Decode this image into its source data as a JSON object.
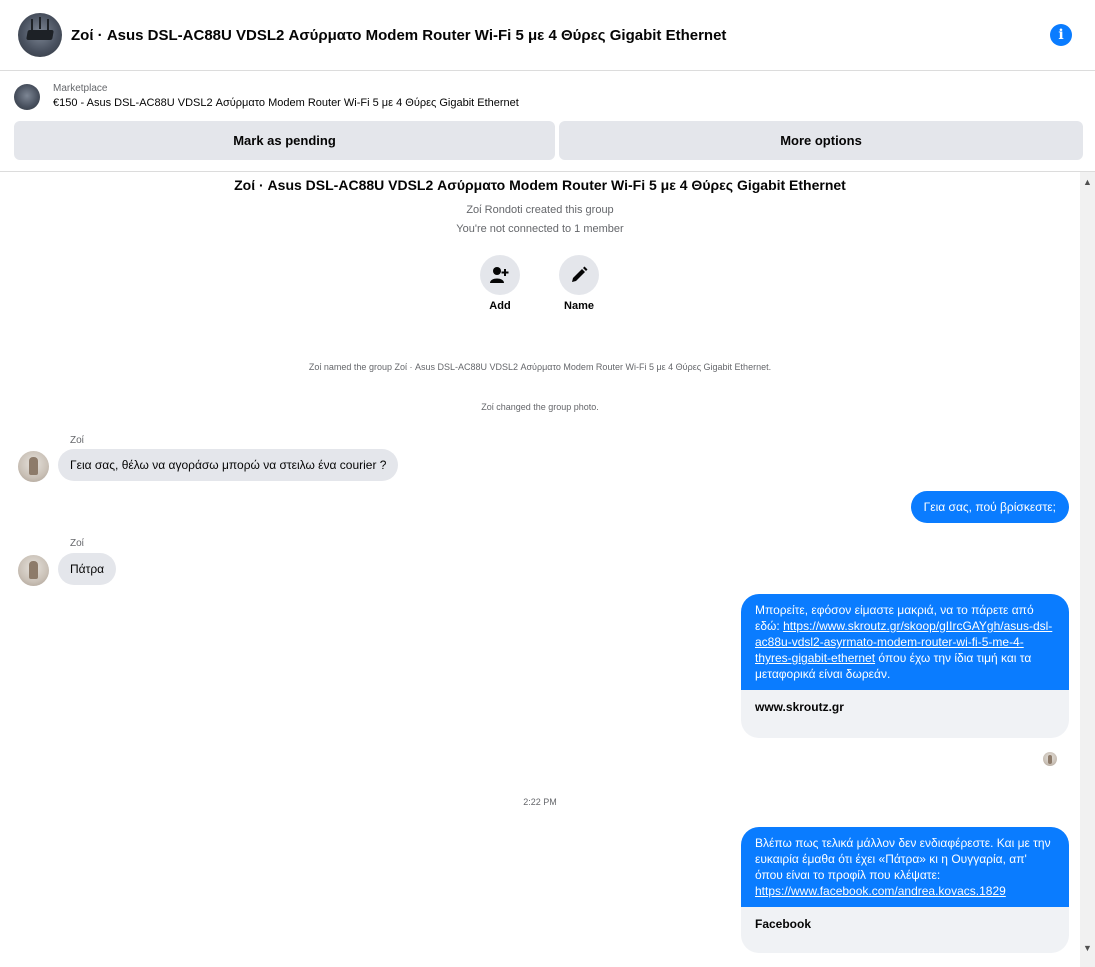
{
  "header": {
    "title": "Zοί · Asus DSL-AC88U VDSL2 Ασύρματο Modem Router Wi-Fi 5 με 4 Θύρες Gigabit Ethernet",
    "info_icon": "info-icon"
  },
  "marketplace": {
    "label": "Marketplace",
    "item": "€150 - Asus DSL-AC88U VDSL2 Ασύρματο Modem Router Wi-Fi 5 με 4 Θύρες Gigabit Ethernet",
    "pending_button": "Mark as pending",
    "more_button": "More options"
  },
  "intro": {
    "title": "Zοί · Asus DSL-AC88U VDSL2 Ασύρματο Modem Router Wi-Fi 5 με 4 Θύρες Gigabit Ethernet",
    "created": "Zοί Rondoti created this group",
    "connection": "You're not connected to 1 member",
    "actions": [
      {
        "label": "Add",
        "icon": "add-person-icon"
      },
      {
        "label": "Name",
        "icon": "pencil-icon"
      }
    ]
  },
  "system_messages": [
    "Zοί named the group Zοί · Asus DSL-AC88U VDSL2 Ασύρματο Modem Router Wi-Fi 5 με 4 Θύρες Gigabit Ethernet.",
    "Zοί changed the group photo."
  ],
  "messages": [
    {
      "sender": "Zοί",
      "text": "Γεια σας, θέλω να αγοράσω μπορώ να στειλω ένα courier ?"
    },
    {
      "sender": "me",
      "text": "Γεια σας, πού βρίσκεστε;"
    },
    {
      "sender": "Zοί",
      "text": "Πάτρα"
    },
    {
      "sender": "me",
      "text_before": "Μπορείτε, εφόσον είμαστε μακριά, να το πάρετε από εδώ: ",
      "link": "https://www.skroutz.gr/skoop/gIIrcGAYgh/asus-dsl-ac88u-vdsl2-asyrmato-modem-router-wi-fi-5-me-4-thyres-gigabit-ethernet",
      "text_after": " όπου έχω την ίδια τιμή και τα μεταφορικά είναι δωρεάν.",
      "preview": "www.skroutz.gr"
    },
    {
      "sender": "me",
      "text_before": "Βλέπω πως τελικά μάλλον δεν ενδιαφέρεστε. Και με την ευκαιρία έμαθα ότι έχει «Πάτρα» κι η Ουγγαρία, απ' όπου είναι το προφίλ που κλέψατε: ",
      "link": "https://www.facebook.com/andrea.kovacs.1829",
      "text_after": "",
      "preview": "Facebook"
    }
  ],
  "timestamp": "2:22 PM",
  "colors": {
    "accent": "#0a7cff",
    "incoming_bubble": "#e4e6eb",
    "button_bg": "#e4e6eb"
  }
}
